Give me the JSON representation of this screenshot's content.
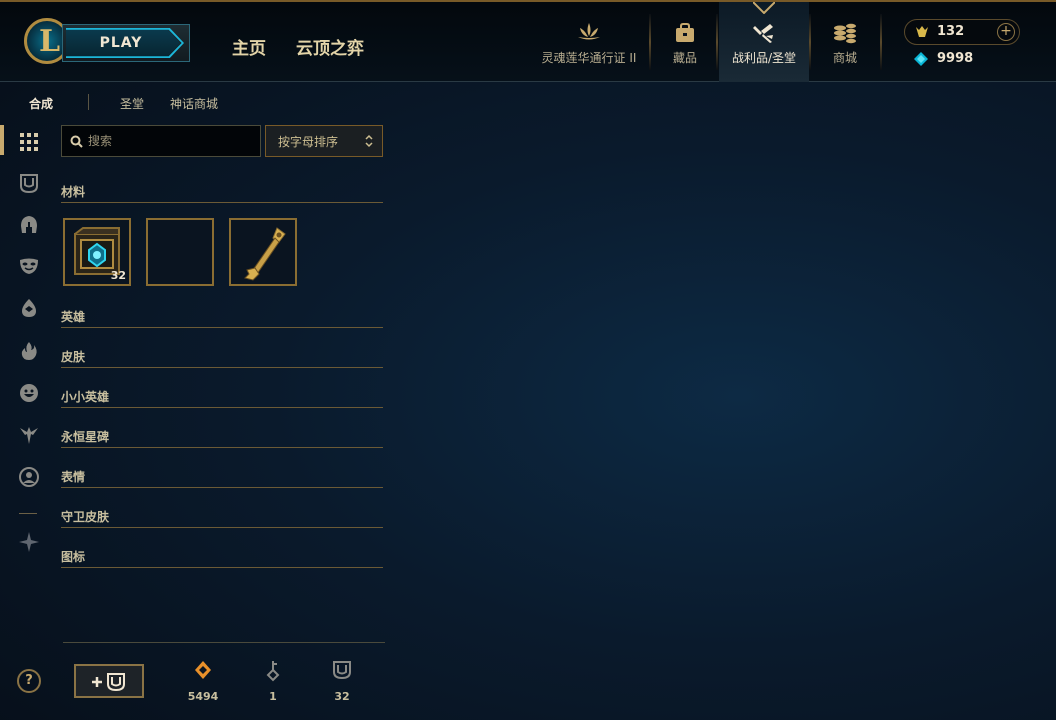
{
  "header": {
    "play_label": "PLAY",
    "nav": [
      "主页",
      "云顶之弈"
    ],
    "items": [
      {
        "label": "灵魂莲华通行证 II",
        "icon": "lotus-icon"
      },
      {
        "label": "藏品",
        "icon": "collection-bag-icon"
      },
      {
        "label": "战利品/圣堂",
        "icon": "loot-hammer-icon",
        "active": true
      },
      {
        "label": "商城",
        "icon": "coins-store-icon"
      }
    ],
    "rp": "132",
    "blue_essence": "9998",
    "add_label": "+"
  },
  "subtabs": [
    "合成",
    "圣堂",
    "神话商城"
  ],
  "search": {
    "placeholder": "搜索"
  },
  "sort": {
    "label": "按字母排序"
  },
  "categories": [
    "材料",
    "英雄",
    "皮肤",
    "小小英雄",
    "永恒星碑",
    "表情",
    "守卫皮肤",
    "图标"
  ],
  "materials": [
    {
      "name": "hextech-chest",
      "count": "32"
    },
    {
      "name": "empty-slot",
      "count": ""
    },
    {
      "name": "hextech-key",
      "count": ""
    }
  ],
  "footer": {
    "help": "?",
    "orange_essence": "5494",
    "keys": "1",
    "chests": "32"
  },
  "colors": {
    "gold": "#c8aa6e",
    "accent_cyan": "#1cb6d8",
    "background": "#0a1a2c"
  }
}
